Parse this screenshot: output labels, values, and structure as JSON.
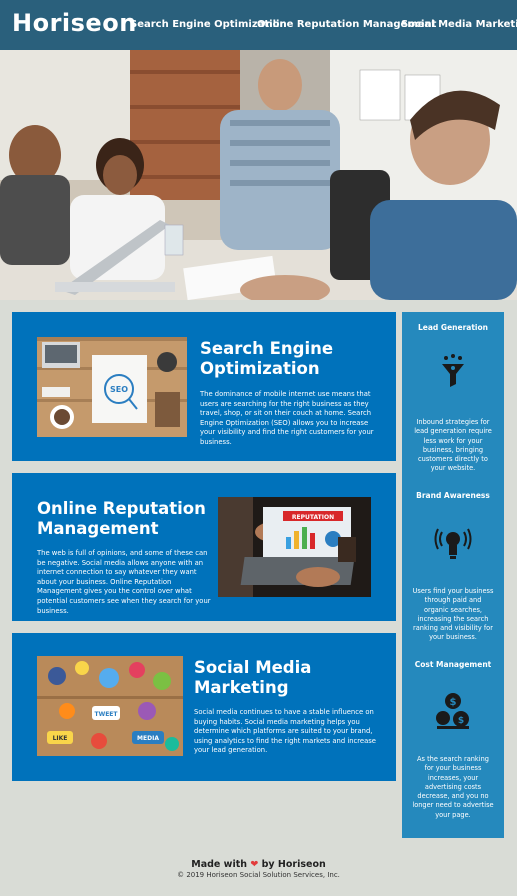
{
  "header": {
    "logo": "Horiseon",
    "nav": [
      {
        "label": "Search Engine Optimization"
      },
      {
        "label": "Online Reputation Management"
      },
      {
        "label": "Social Media Marketing"
      }
    ]
  },
  "articles": [
    {
      "title_line1": "Search Engine",
      "title_line2": "Optimization",
      "text": "The dominance of mobile internet use means that users are searching for the right business as they travel, shop, or sit on their couch at home. Search Engine Optimization (SEO) allows you to increase your visibility and find the right customers for your business."
    },
    {
      "title_line1": "Online Reputation",
      "title_line2": "Management",
      "text": "The web is full of opinions, and some of these can be negative. Social media allows anyone with an internet connection to say whatever they want about your business. Online Reputation Management gives you the control over what potential customers see when they search for your business."
    },
    {
      "title_line1": "Social Media",
      "title_line2": "Marketing",
      "text": "Social media continues to have a stable influence on buying habits. Social media marketing helps you determine which platforms are suited to your brand, using analytics to find the right markets and increase your lead generation."
    }
  ],
  "images": {
    "seo_board_text": "SEO",
    "orm_banner_text": "REPUTATION",
    "smm_tweet_text": "TWEET",
    "smm_like_text": "LIKE",
    "smm_media_text": "MEDIA"
  },
  "sidebar": [
    {
      "title": "Lead Generation",
      "icon": "funnel-icon",
      "text": "Inbound strategies for lead generation require less work for your business, bringing customers directly to your website."
    },
    {
      "title": "Brand Awareness",
      "icon": "brand-lightbulb-icon",
      "text": "Users find your business through paid and organic searches, increasing the search ranking and visibility for your business."
    },
    {
      "title": "Cost Management",
      "icon": "money-icon",
      "text": "As the search ranking for your business increases, your advertising costs decrease, and you no longer need to advertise your page."
    }
  ],
  "footer": {
    "made_with": "Made with",
    "by": "by Horiseon",
    "copyright": "© 2019 Horiseon Social Solution Services, Inc."
  },
  "colors": {
    "header": "#2a607c",
    "article": "#0072bb",
    "sidebar": "#2589bd",
    "background": "#d9dcd6"
  }
}
